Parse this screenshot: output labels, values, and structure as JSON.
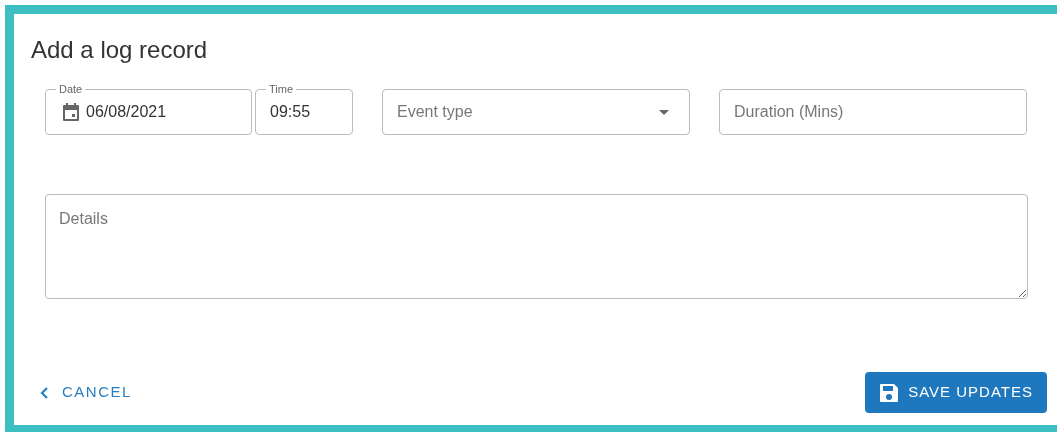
{
  "title": "Add a log record",
  "date": {
    "label": "Date",
    "value": "06/08/2021"
  },
  "time": {
    "label": "Time",
    "value": "09:55"
  },
  "event_type": {
    "placeholder": "Event type"
  },
  "duration": {
    "placeholder": "Duration (Mins)"
  },
  "details": {
    "placeholder": "Details"
  },
  "cancel": {
    "label": "CANCEL"
  },
  "save": {
    "label": "SAVE UPDATES"
  }
}
